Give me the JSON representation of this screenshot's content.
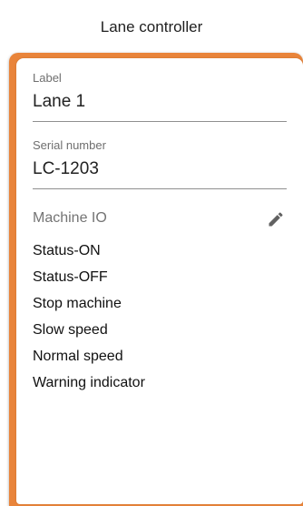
{
  "header": {
    "title": "Lane controller"
  },
  "card": {
    "label_field": {
      "label": "Label",
      "value": "Lane 1"
    },
    "serial_field": {
      "label": "Serial number",
      "value": "LC-1203"
    },
    "machine_io": {
      "title": "Machine IO",
      "edit_icon": "pencil-icon",
      "items": [
        "Status-ON",
        "Status-OFF",
        "Stop machine",
        "Slow speed",
        "Normal speed",
        "Warning indicator"
      ]
    }
  },
  "colors": {
    "accent": "#e9843a",
    "text_primary": "#222222",
    "text_secondary": "#6f6f6f",
    "divider": "#8f8f8f"
  }
}
